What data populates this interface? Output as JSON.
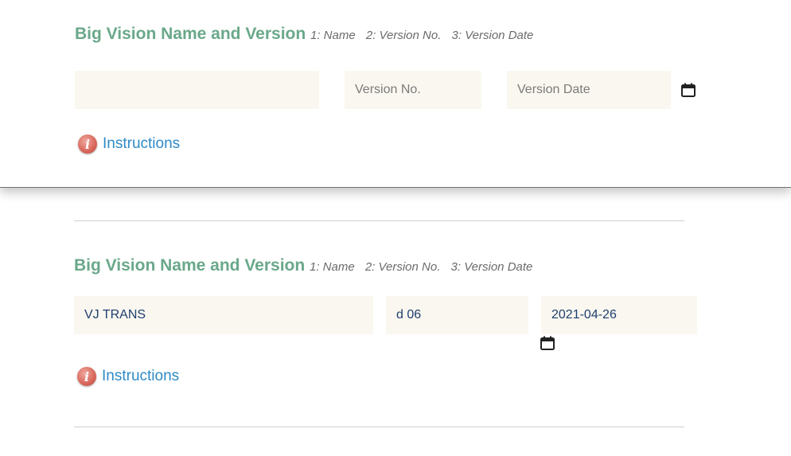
{
  "top_section": {
    "title": "Big Vision Name and Version",
    "hints": [
      "1: Name",
      "2: Version No.",
      "3: Version Date"
    ],
    "name_field": {
      "value": "",
      "placeholder": ""
    },
    "version_field": {
      "value": "",
      "placeholder": "Version No."
    },
    "date_field": {
      "value": "",
      "placeholder": "Version Date"
    },
    "instructions_label": "Instructions"
  },
  "bottom_section": {
    "title": "Big Vision Name and Version",
    "hints": [
      "1: Name",
      "2: Version No.",
      "3: Version Date"
    ],
    "name_field": {
      "value": "VJ TRANS"
    },
    "version_field": {
      "value": "d 06"
    },
    "date_field": {
      "value": "2021-04-26"
    },
    "instructions_label": "Instructions"
  },
  "icons": {
    "calendar": "calendar-icon",
    "info": "info-icon"
  },
  "colors": {
    "title": "#6aa88a",
    "link": "#2e8ac6",
    "field_bg": "#faf7f0",
    "value_text": "#1d3f6e",
    "info_icon": "#d8665a"
  }
}
